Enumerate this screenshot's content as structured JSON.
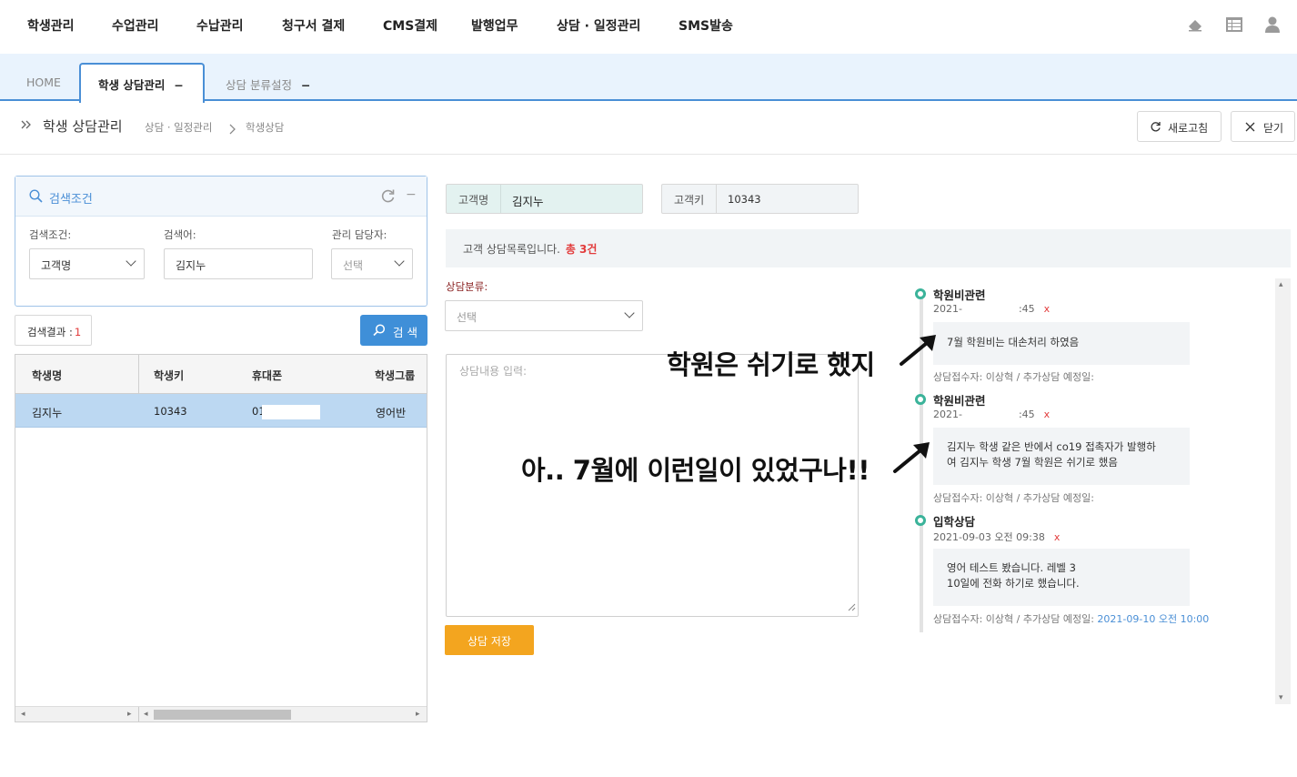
{
  "nav": {
    "menus": [
      "학생관리",
      "수업관리",
      "수납관리",
      "청구서 결제",
      "CMS결제",
      "발행업무",
      "상담 · 일정관리",
      "SMS발송"
    ],
    "icons": [
      "eraser-icon",
      "table-icon",
      "user-icon"
    ]
  },
  "tabs": {
    "home": "HOME",
    "active": "학생 상담관리",
    "active_close": "−",
    "second": "상담 분류설정",
    "second_close": "−"
  },
  "breadcrumb": {
    "title": "학생 상담관리",
    "level1": "상담 · 일정관리",
    "level2": "학생상담"
  },
  "toolbar": {
    "refresh": "새로고침",
    "close": "닫기"
  },
  "search": {
    "header": "검색조건",
    "condition_label": "검색조건:",
    "condition_value": "고객명",
    "keyword_label": "검색어:",
    "keyword_value": "김지누",
    "manager_label": "관리 담당자:",
    "manager_value": "선택",
    "result_label": "검색결과 :",
    "result_count": "1",
    "search_button": "검 색"
  },
  "grid": {
    "columns": [
      "학생명",
      "학생키",
      "휴대폰",
      "학생그룹"
    ],
    "rows": [
      {
        "name": "김지누",
        "key": "10343",
        "phone": "01",
        "group": "영어반"
      }
    ]
  },
  "customer": {
    "name_label": "고객명",
    "name_value": "김지누",
    "key_label": "고객키",
    "key_value": "10343"
  },
  "notice": {
    "text": "고객 상담목록입니다.",
    "total": "총 3건"
  },
  "form": {
    "category_label": "상담분류:",
    "category_placeholder": "선택",
    "content_placeholder": "상담내용 입력:",
    "save_button": "상담 저장"
  },
  "timeline": [
    {
      "title": "학원비관련",
      "date": "2021-",
      "time": ":45",
      "delete": "x",
      "lines": [
        "7월 학원비는 대손처리 하였음"
      ],
      "footer": "상담접수자: 이상혁 / 추가상담 예정일:",
      "next_date": ""
    },
    {
      "title": "학원비관련",
      "date": "2021-",
      "time": ":45",
      "delete": "x",
      "lines": [
        "김지누 학생 같은 반에서 co19 접촉자가 발행하",
        "여 김지누 학생 7월 학원은 쉬기로 했음"
      ],
      "footer": "상담접수자: 이상혁 / 추가상담 예정일:",
      "next_date": ""
    },
    {
      "title": "입학상담",
      "date": "2021-09-03 오전 09:38",
      "time": "",
      "delete": "x",
      "lines": [
        "영어 테스트 봤습니다. 레벨 3",
        "10일에 전화 하기로 했습니다."
      ],
      "footer": "상담접수자: 이상혁 / 추가상담 예정일:",
      "next_date": "2021-09-10 오전 10:00"
    }
  ],
  "annotations": {
    "first": "학원은 쉬기로 했지",
    "second": "아.. 7월에 이런일이 있었구나!!"
  },
  "colors": {
    "accent": "#4a8fd6",
    "save": "#f3a51f",
    "timeline_dot": "#3bb39a",
    "selected_row": "#bcd8f2",
    "delete": "#e23b3b"
  }
}
